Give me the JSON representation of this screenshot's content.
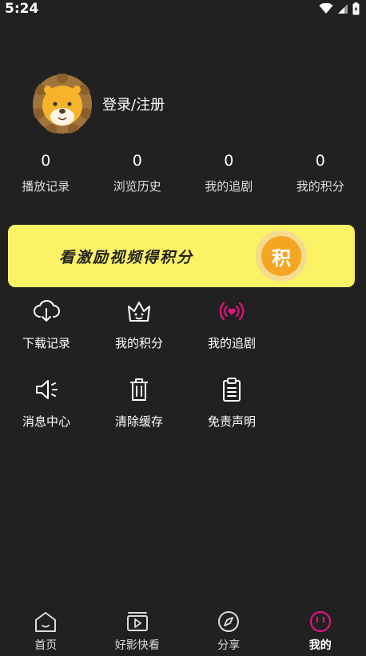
{
  "status": {
    "time": "5:24"
  },
  "profile": {
    "login_label": "登录/注册"
  },
  "stats": [
    {
      "value": "0",
      "label": "播放记录"
    },
    {
      "value": "0",
      "label": "浏览历史"
    },
    {
      "value": "0",
      "label": "我的追剧"
    },
    {
      "value": "0",
      "label": "我的积分"
    }
  ],
  "banner": {
    "text": "看激励视频得积分",
    "coin_char": "积"
  },
  "menu": [
    {
      "label": "下载记录",
      "icon": "cloud-download-icon"
    },
    {
      "label": "我的积分",
      "icon": "crown-icon"
    },
    {
      "label": "我的追剧",
      "icon": "broadcast-heart-icon"
    },
    {
      "label": "消息中心",
      "icon": "speaker-icon"
    },
    {
      "label": "清除缓存",
      "icon": "trash-icon"
    },
    {
      "label": "免责声明",
      "icon": "clipboard-icon"
    }
  ],
  "tabs": [
    {
      "label": "首页",
      "icon": "home-icon"
    },
    {
      "label": "好影快看",
      "icon": "video-icon"
    },
    {
      "label": "分享",
      "icon": "compass-icon"
    },
    {
      "label": "我的",
      "icon": "smiley-icon"
    }
  ],
  "colors": {
    "background": "#212121",
    "banner": "#fcf266",
    "accent": "#e0157d",
    "coin": "#f4a623"
  }
}
